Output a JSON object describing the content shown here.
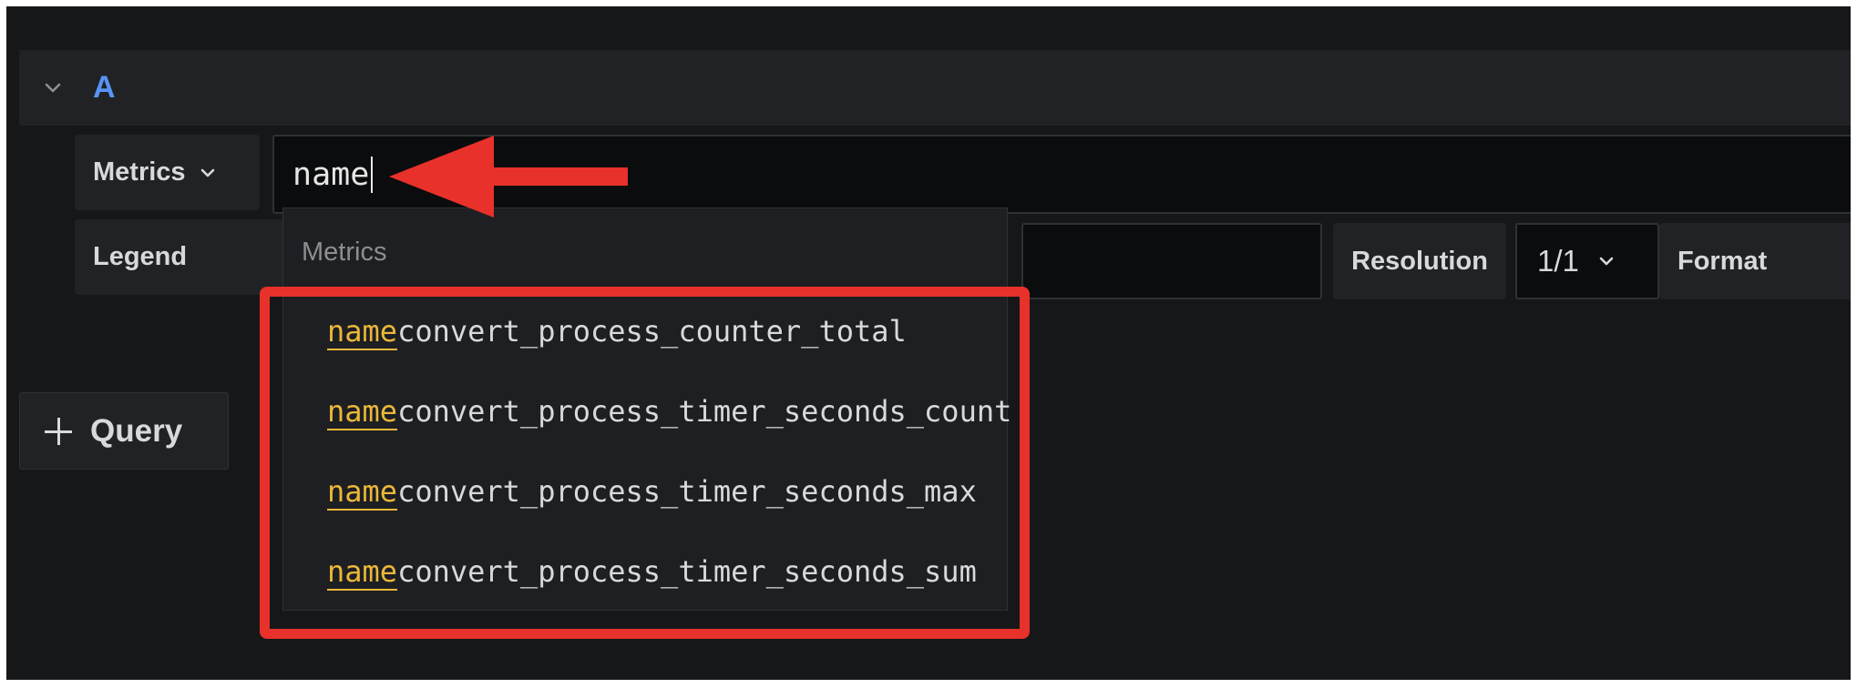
{
  "query_row": {
    "ref_id": "A"
  },
  "editor": {
    "metrics_button_label": "Metrics",
    "query_value": "name",
    "legend_label": "Legend",
    "resolution_label": "Resolution",
    "resolution_value": "1/1",
    "format_label": "Format"
  },
  "suggestions": {
    "header": "Metrics",
    "items": [
      {
        "match": "name",
        "rest": "convert_process_counter_total"
      },
      {
        "match": "name",
        "rest": "convert_process_timer_seconds_count"
      },
      {
        "match": "name",
        "rest": "convert_process_timer_seconds_max"
      },
      {
        "match": "name",
        "rest": "convert_process_timer_seconds_sum"
      }
    ]
  },
  "actions": {
    "add_query_label": "Query"
  },
  "colors": {
    "ref_id": "#5794f2",
    "match_highlight": "#eab839",
    "annotation_red": "#e8312a",
    "background": "#161719"
  },
  "icons": {
    "collapse": "chevron-down-icon",
    "dropdown": "chevron-down-icon",
    "add": "plus-icon",
    "annotation": "arrow-left-icon"
  }
}
